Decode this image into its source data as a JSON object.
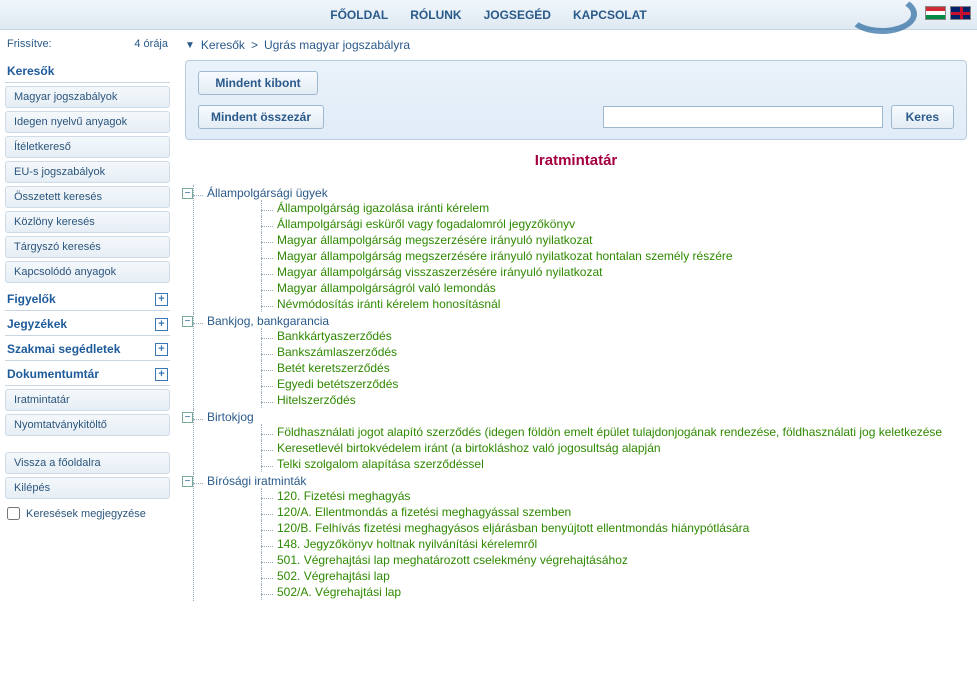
{
  "nav": {
    "home": "FŐOLDAL",
    "about": "RÓLUNK",
    "legal": "JOGSEGÉD",
    "contact": "KAPCSOLAT"
  },
  "status": {
    "label": "Frissítve:",
    "ago": "4 órája"
  },
  "side": {
    "searchers": {
      "title": "Keresők",
      "items": {
        "hu": "Magyar jogszabályok",
        "foreign": "Idegen nyelvű anyagok",
        "verdict": "Ítéletkereső",
        "eu": "EU-s jogszabályok",
        "composite": "Összetett keresés",
        "gazette": "Közlöny keresés",
        "subject": "Tárgyszó keresés",
        "related": "Kapcsolódó anyagok"
      }
    },
    "watchers": "Figyelők",
    "registers": "Jegyzékek",
    "aids": "Szakmai segédletek",
    "docs": {
      "title": "Dokumentumtár",
      "items": {
        "forms": "Iratmintatár",
        "printfill": "Nyomtatványkitöltő"
      }
    },
    "back": "Vissza a főoldalra",
    "exit": "Kilépés",
    "remember": "Keresések megjegyzése"
  },
  "breadcrumb": {
    "root": "Keresők",
    "current": "Ugrás magyar jogszabályra"
  },
  "buttons": {
    "expand": "Mindent kibont",
    "collapse": "Mindent összezár",
    "search": "Keres"
  },
  "search": {
    "placeholder": ""
  },
  "page_title": "Iratmintatár",
  "tree": {
    "g1": {
      "label": "Állampolgársági ügyek",
      "items": [
        "Állampolgárság igazolása iránti kérelem",
        "Állampolgársági esküről vagy fogadalomról jegyzőkönyv",
        "Magyar állampolgárság megszerzésére irányuló nyilatkozat",
        "Magyar állampolgárság megszerzésére irányuló nyilatkozat hontalan személy részére",
        "Magyar állampolgárság visszaszerzésére irányuló nyilatkozat",
        "Magyar állampolgárságról való lemondás",
        "Névmódosítás iránti kérelem honosításnál"
      ]
    },
    "g2": {
      "label": "Bankjog, bankgarancia",
      "items": [
        "Bankkártyaszerződés",
        "Bankszámlaszerződés",
        "Betét keretszerződés",
        "Egyedi betétszerződés",
        "Hitelszerződés"
      ]
    },
    "g3": {
      "label": "Birtokjog",
      "items": [
        "Földhasználati jogot alapító szerződés (idegen földön emelt épület tulajdonjogának rendezése, földhasználati jog keletkezése",
        "Keresetlevél birtokvédelem iránt (a birtokláshoz való jogosultság alapján",
        "Telki szolgalom alapítása szerződéssel"
      ]
    },
    "g4": {
      "label": "Bírósági iratminták",
      "items": [
        "120. Fizetési meghagyás",
        "120/A. Ellentmondás a fizetési meghagyással szemben",
        "120/B. Felhívás fizetési meghagyásos eljárásban benyújtott ellentmondás hiánypótlására",
        "148. Jegyzőkönyv holtnak nyilvánítási kérelemről",
        "501. Végrehajtási lap meghatározott cselekmény végrehajtásához",
        "502. Végrehajtási lap",
        "502/A. Végrehajtási lap"
      ]
    }
  }
}
